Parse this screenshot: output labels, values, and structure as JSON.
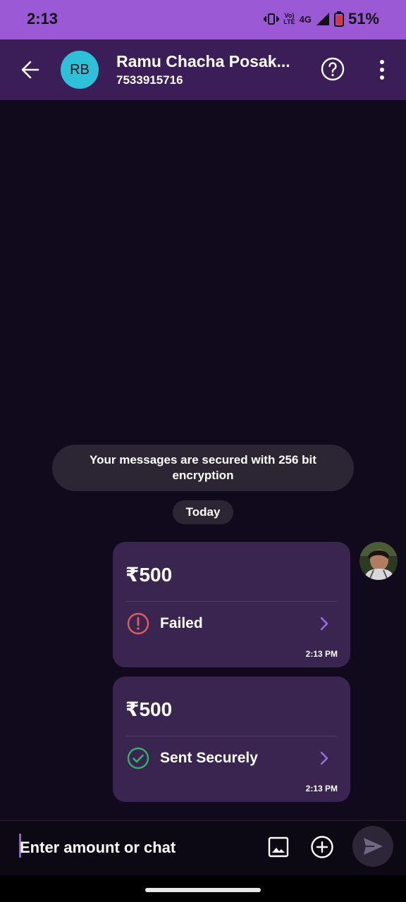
{
  "status_bar": {
    "time": "2:13",
    "network": "4G",
    "volte_top": "Vo)",
    "volte_bottom": "LTE",
    "battery": "51%"
  },
  "header": {
    "avatar_initials": "RB",
    "contact_name": "Ramu Chacha Posak...",
    "contact_phone": "7533915716",
    "icons": [
      "back-arrow-icon",
      "help-icon",
      "more-vertical-icon"
    ]
  },
  "chat": {
    "encryption_notice": "Your messages are secured with 256 bit encryption",
    "day_label": "Today",
    "payments": [
      {
        "amount": "₹500",
        "status": "Failed",
        "status_icon": "error-icon",
        "status_color": "#e35d5d",
        "time": "2:13 PM"
      },
      {
        "amount": "₹500",
        "status": "Sent Securely",
        "status_icon": "check-circle-icon",
        "status_color": "#2fb36a",
        "time": "2:13 PM"
      }
    ]
  },
  "composer": {
    "placeholder": "Enter amount or chat",
    "icons": [
      "image-icon",
      "plus-circle-icon",
      "send-icon"
    ]
  },
  "colors": {
    "status_bar_bg": "#9b59d6",
    "header_bg": "#3b1e58",
    "chat_bg": "#110a1d",
    "card_bg": "#3a2551",
    "accent": "#8f5fd9",
    "avatar_bg": "#2fc0d9"
  }
}
